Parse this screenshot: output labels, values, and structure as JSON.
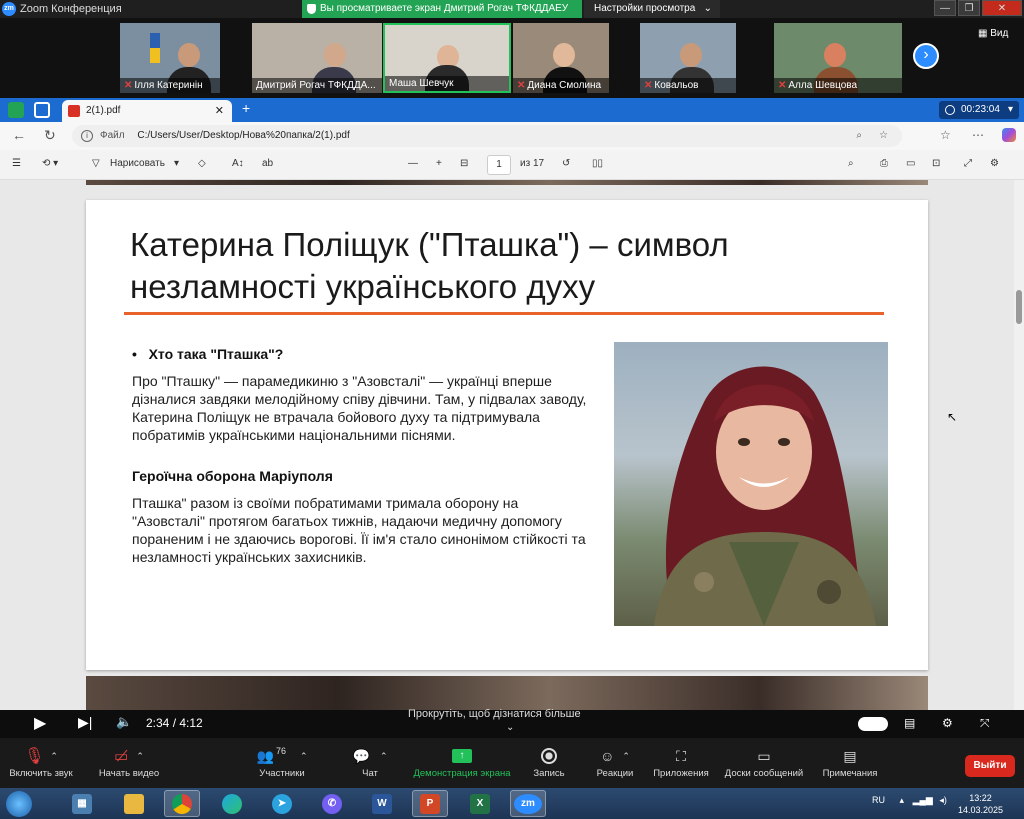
{
  "zoom": {
    "window_title": "Zoom Конференция",
    "share_banner": "Вы просматриваете экран Дмитрий Рогач ТФКДДАЕУ",
    "view_settings": "Настройки просмотра",
    "view_button": "Вид",
    "participants": [
      {
        "name": "Ілля Катеринін",
        "muted": true
      },
      {
        "name": "Дмитрий Рогач ТФКДДА...",
        "muted": false
      },
      {
        "name": "Маша Шевчук",
        "muted": false
      },
      {
        "name": "Диана Смолина",
        "muted": true
      },
      {
        "name": "Ковальов",
        "muted": true
      },
      {
        "name": "Алла Шевцова",
        "muted": true
      }
    ]
  },
  "browser": {
    "tab_title": "2(1).pdf",
    "timer": "00:23:04",
    "url_prefix": "Файл",
    "url_path": "C:/Users/User/Desktop/Нова%20папка/2(1).pdf",
    "pdf_toolbar": {
      "draw_label": "Нарисовать",
      "page_current": "1",
      "page_total": "из 17"
    }
  },
  "slide": {
    "title": "Катерина Поліщук (\"Пташка\") – символ незламності українського духу",
    "bullet_heading": "Хто така \"Пташка\"?",
    "paragraph1": "Про \"Пташку\" — парамедикиню з \"Азовсталі\" — українці вперше дізналися завдяки мелодійному співу дівчини. Там, у підвалах заводу, Катерина Поліщук не втрачала бойового духу та підтримувала побратимів українськими національними піснями.",
    "subheading": "Героїчна оборона Маріуполя",
    "paragraph2": "Пташка\" разом із своїми побратимами тримала оборону на \"Азовсталі\" протягом багатьох тижнів, надаючи медичну допомогу пораненим і не здаючись ворогові. Її ім'я стало синонімом стійкості та незламності українських захисників."
  },
  "player": {
    "time": "2:34 / 4:12",
    "caption": "Прокрутіть, щоб дізнатися більше"
  },
  "controls": {
    "audio": "Включить звук",
    "video": "Начать видео",
    "participants": "Участники",
    "participants_count": "76",
    "chat": "Чат",
    "share": "Демонстрация экрана",
    "record": "Запись",
    "reactions": "Реакции",
    "apps": "Приложения",
    "whiteboards": "Доски сообщений",
    "notes": "Примечания",
    "exit": "Выйти"
  },
  "taskbar": {
    "lang": "RU",
    "time": "13:22",
    "date": "14.03.2025"
  },
  "colors": {
    "zoom_blue": "#2d8cff",
    "share_green": "#23a455",
    "browser_blue": "#1b6bd1",
    "accent_orange": "#e8622c",
    "exit_red": "#d9291f"
  }
}
